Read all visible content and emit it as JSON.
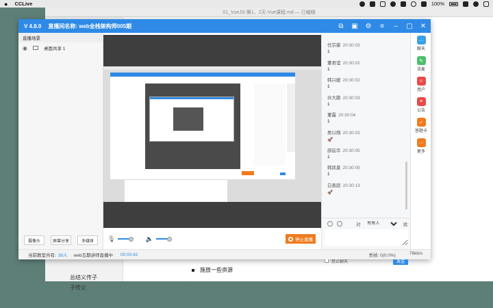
{
  "menubar": {
    "app_name": "CCLive",
    "battery": "100%"
  },
  "editor": {
    "title": "01_VueJS-第1、2天-Vue课程.md — 已编辑",
    "sidebar": [
      "总结义传子",
      "子传父"
    ],
    "bullet": "施放一些资源",
    "partial_line": "..."
  },
  "cc": {
    "version": "V 4.8.0",
    "room": "直播间名称: web全栈架构师005期",
    "left": {
      "header": "直播场景",
      "scene": "桌面共享 1",
      "buttons": [
        "摄像头",
        "屏幕分享",
        "多媒体"
      ]
    },
    "stop_label": "停止直播",
    "chat": {
      "messages": [
        {
          "name": "任宗豪",
          "time": "20:30:03",
          "text": "1"
        },
        {
          "name": "董君谊",
          "time": "20:30:02",
          "text": "1"
        },
        {
          "name": "韩兴媛",
          "time": "20:30:02",
          "text": "1"
        },
        {
          "name": "孙大鹏",
          "time": "20:30:03",
          "text": "1"
        },
        {
          "name": "董露",
          "time": "20:30:04",
          "text": "1"
        },
        {
          "name": "吴以翔",
          "time": "20:30:03",
          "text": "🚀"
        },
        {
          "name": "邵廷华",
          "time": "20:30:05",
          "text": "1"
        },
        {
          "name": "韩凤夏",
          "time": "20:30:05",
          "text": "1"
        },
        {
          "name": "白善超",
          "time": "20:30:13",
          "text": "🚀"
        }
      ],
      "to_label": "对",
      "target": "所有人",
      "say_label": "说:",
      "mute_label": "禁止聊天",
      "send_label": "发送"
    },
    "sidebar": [
      {
        "label": "聊天",
        "color": "#3aa0e8",
        "glyph": "…"
      },
      {
        "label": "流麦",
        "color": "#4cbf6a",
        "glyph": "✎"
      },
      {
        "label": "用户",
        "color": "#e84a4a",
        "glyph": "☺"
      },
      {
        "label": "公告",
        "color": "#e84a4a",
        "glyph": "≡"
      },
      {
        "label": "答题卡",
        "color": "#f07b1e",
        "glyph": "✓"
      },
      {
        "label": "更多",
        "color": "#f07b1e",
        "glyph": "⋯"
      }
    ],
    "status": {
      "online_label": "当前教室共有:",
      "online_count": "39人",
      "live_label": "web五期讲师直播中",
      "duration": "00:00:42",
      "loss": "丢帧: 0(0.0%)",
      "rate": "78kb/s"
    }
  }
}
